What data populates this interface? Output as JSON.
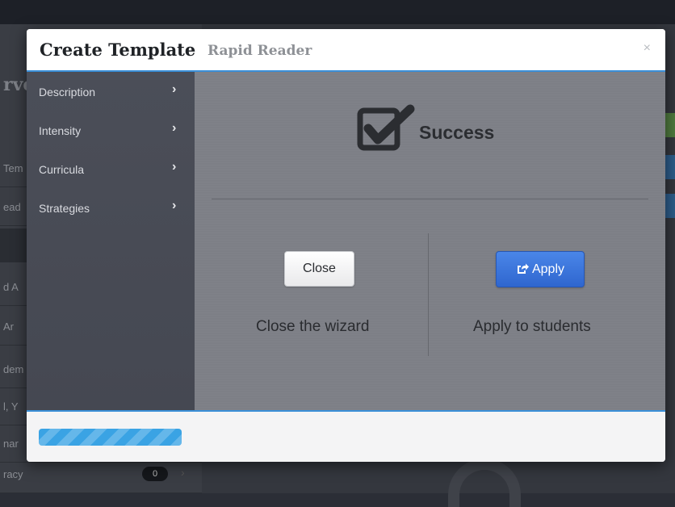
{
  "modal": {
    "title": "Create Template",
    "subtitle": "Rapid Reader",
    "close_glyph": "×"
  },
  "sidebar": {
    "items": [
      {
        "label": "Description",
        "icon": "chevron-right-icon"
      },
      {
        "label": "Intensity",
        "icon": "chevron-right-icon"
      },
      {
        "label": "Curricula",
        "icon": "chevron-right-icon"
      },
      {
        "label": "Strategies",
        "icon": "chevron-right-icon"
      }
    ]
  },
  "status": {
    "icon": "checkbox-checked-icon",
    "text": "Success"
  },
  "actions": {
    "close_label": "Close",
    "close_caption": "Close the wizard",
    "apply_label": "Apply",
    "apply_icon": "share-icon",
    "apply_caption": "Apply to students"
  },
  "footer": {
    "progress": 1.0
  },
  "background": {
    "title_fragment": "rve",
    "rows": [
      "Tem",
      "ead",
      "d A",
      " Ar",
      "dem",
      "l, Y",
      "nar",
      "racy"
    ],
    "badge": "0"
  },
  "colors": {
    "accent": "#3a8fd8",
    "apply_button": "#3570d9",
    "sidebar": "#4a4d57",
    "content": "#7d7f86",
    "progress_fill": "#3aa3e4"
  }
}
